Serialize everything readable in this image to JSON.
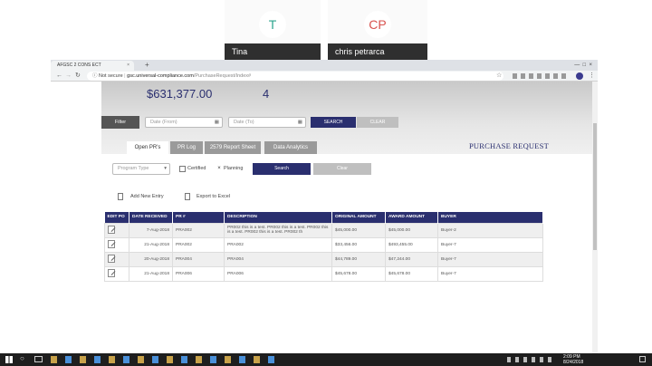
{
  "call": {
    "participants": [
      {
        "initial": "T",
        "name": "Tina",
        "color": "#2fa58f"
      },
      {
        "initial": "CP",
        "name": "chris petrarca",
        "color": "#d9534f"
      }
    ]
  },
  "browser": {
    "tab_title": "AFGSC 2 CONS ECT",
    "new_tab": "+",
    "security": "Not secure",
    "url_host": "gsc.universal-compliance.com",
    "url_path": "/PurchaseRequest/Index#"
  },
  "summary": {
    "amount": "$631,377.00",
    "count": "4"
  },
  "filter": {
    "label": "Filter",
    "date_from_placeholder": "Date (From)",
    "date_to_placeholder": "Date (To)",
    "search": "SEARCH",
    "clear": "CLEAR"
  },
  "tabs": [
    {
      "label": "Open PR's",
      "active": true
    },
    {
      "label": "PR Log",
      "active": false
    },
    {
      "label": "2579 Report Sheet",
      "active": false
    },
    {
      "label": "Data Analytics",
      "active": false
    }
  ],
  "page_title": "PURCHASE REQUEST",
  "subfilter": {
    "program_type": "Program Type",
    "certified": "Certified",
    "planning": "Planning",
    "planning_check": "×",
    "search": "Search",
    "clear": "Clear"
  },
  "actions": {
    "add": "Add New Entry",
    "export": "Export to Excel"
  },
  "table": {
    "headers": [
      "EDIT PO",
      "DATE RECEIVED",
      "PR #",
      "DESCRIPTION",
      "ORIGINAL AMOUNT",
      "AWARD AMOUNT",
      "BUYER"
    ],
    "rows": [
      {
        "date": "7-Aug-2018",
        "pr": "PRA002",
        "desc": "PR002 this is a test. PR002 this is a test. PR002 this is a test. PR002 this is a test. PR002 th",
        "orig": "$45,000.00",
        "award": "$45,000.00",
        "buyer": "Buyer-2"
      },
      {
        "date": "21-Aug-2018",
        "pr": "PRA002",
        "desc": "PRA002",
        "orig": "$33,456.00",
        "award": "$493,455.00",
        "buyer": "Buyer-7"
      },
      {
        "date": "20-Aug-2018",
        "pr": "PRA004",
        "desc": "PRA004",
        "orig": "$44,789.00",
        "award": "$47,244.00",
        "buyer": "Buyer-7"
      },
      {
        "date": "21-Aug-2018",
        "pr": "PRA006",
        "desc": "PRA006",
        "orig": "$45,678.00",
        "award": "$45,678.00",
        "buyer": "Buyer-7"
      }
    ]
  },
  "taskbar": {
    "time": "2:09 PM",
    "date": "8/24/2018"
  },
  "colors": {
    "navy": "#2a2f6f",
    "filter_bg": "#555555",
    "search_btn": "#2a2f6f",
    "clear_btn": "#bfbfbf"
  }
}
